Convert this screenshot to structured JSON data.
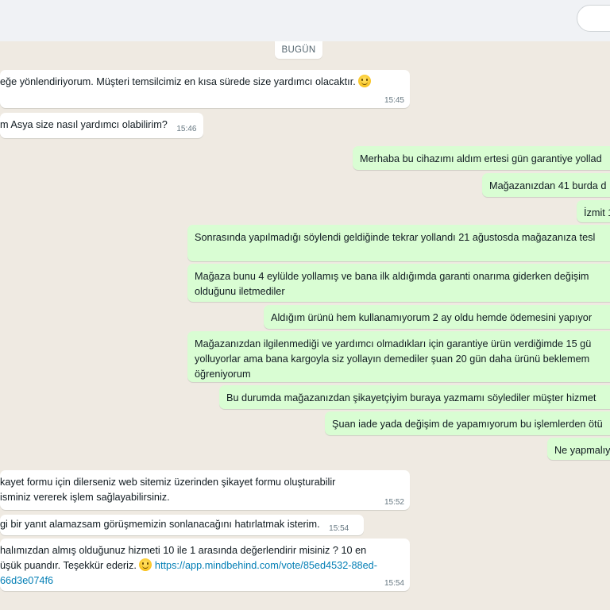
{
  "date_label": "BUGÜN",
  "messages": [
    {
      "lines": [
        "eğe yönlendiriyorum. Müşteri temsilcimiz en kısa sürede size yardımcı olacaktır."
      ],
      "time": "15:45"
    },
    {
      "lines": [
        "m Asya size nasıl yardımcı olabilirim?"
      ],
      "time": "15:46"
    },
    {
      "lines": [
        "Merhaba bu cihazımı aldım ertesi gün garantiye yollad"
      ]
    },
    {
      "lines": [
        "Mağazanızdan 41 burda d"
      ]
    },
    {
      "lines": [
        "İzmit 1"
      ]
    },
    {
      "lines": [
        "Sonrasında yapılmadığı söylendi geldiğinde tekrar yollandı 21 ağustosda mağazanıza tesl"
      ]
    },
    {
      "lines": [
        "Mağaza bunu 4 eylülde yollamış ve bana ilk aldığımda garanti onarıma giderken değişim",
        "olduğunu iletmediler"
      ]
    },
    {
      "lines": [
        "Aldığım ürünü hem kullanamıyorum 2 ay oldu hemde ödemesini yapıyor"
      ]
    },
    {
      "lines": [
        "Mağazanızdan ilgilenmediği ve yardımcı olmadıkları için garantiye ürün verdiğimde 15 gü",
        "yolluyorlar ama bana kargoyla siz yollayın demediler şuan 20 gün daha ürünü beklemem",
        "öğreniyorum"
      ]
    },
    {
      "lines": [
        "Bu durumda mağazanızdan şikayetçiyim buraya yazmamı söylediler müşter hizmet"
      ]
    },
    {
      "lines": [
        "Şuan iade yada değişim de yapamıyorum bu işlemlerden ötü"
      ]
    },
    {
      "lines": [
        "Ne yapmalıy"
      ]
    },
    {
      "lines": [
        "kayet formu için dilerseniz web sitemiz üzerinden şikayet formu oluşturabilir",
        "isminiz vererek işlem sağlayabilirsiniz."
      ],
      "time": "15:52"
    },
    {
      "lines": [
        "gi bir yanıt alamazsam görüşmemizin sonlanacağını hatırlatmak isterim."
      ],
      "time": "15:54"
    },
    {
      "lines": [
        "halımızdan almış olduğunuz hizmeti 10 ile 1 arasında değerlendirir misiniz ? 10 en",
        "üşük puandır. Teşekkür ederiz."
      ],
      "link_line": "https://app.mindbehind.com/vote/85ed4532-88ed-",
      "link_cont": "66d3e074f6",
      "time": "15:54"
    }
  ]
}
